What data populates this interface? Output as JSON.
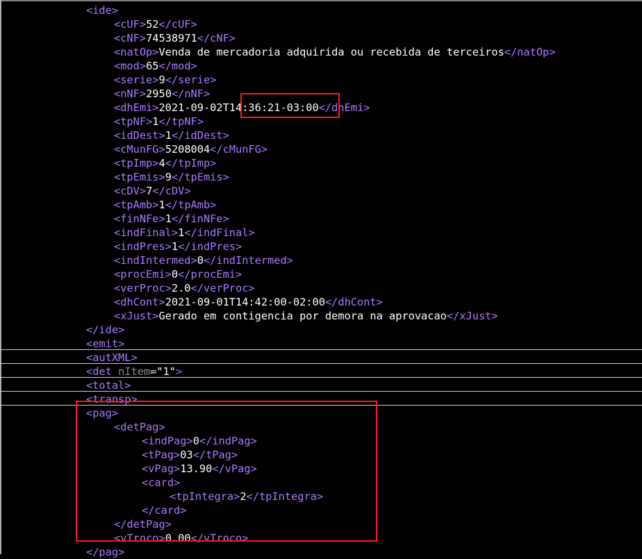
{
  "lines": [
    {
      "indent": 3,
      "parts": [
        {
          "t": "<ide>",
          "c": "t"
        }
      ]
    },
    {
      "indent": 4,
      "parts": [
        {
          "t": "<cUF>",
          "c": "t"
        },
        {
          "t": "52",
          "c": "x"
        },
        {
          "t": "</cUF>",
          "c": "t"
        }
      ]
    },
    {
      "indent": 4,
      "parts": [
        {
          "t": "<cNF>",
          "c": "t"
        },
        {
          "t": "74538971",
          "c": "x"
        },
        {
          "t": "</cNF>",
          "c": "t"
        }
      ]
    },
    {
      "indent": 4,
      "parts": [
        {
          "t": "<natOp>",
          "c": "t"
        },
        {
          "t": "Venda de mercadoria adquirida ou recebida de terceiros",
          "c": "x"
        },
        {
          "t": "</natOp>",
          "c": "t"
        }
      ]
    },
    {
      "indent": 4,
      "parts": [
        {
          "t": "<mod>",
          "c": "t"
        },
        {
          "t": "65",
          "c": "x"
        },
        {
          "t": "</mod>",
          "c": "t"
        }
      ]
    },
    {
      "indent": 4,
      "parts": [
        {
          "t": "<serie>",
          "c": "t"
        },
        {
          "t": "9",
          "c": "x"
        },
        {
          "t": "</serie>",
          "c": "t"
        }
      ]
    },
    {
      "indent": 4,
      "parts": [
        {
          "t": "<nNF>",
          "c": "t"
        },
        {
          "t": "2950",
          "c": "x"
        },
        {
          "t": "</nNF>",
          "c": "t"
        }
      ]
    },
    {
      "indent": 4,
      "parts": [
        {
          "t": "<dhEmi>",
          "c": "t"
        },
        {
          "t": "2021-09-02T14:36:21-03:00",
          "c": "x"
        },
        {
          "t": "</dhEmi>",
          "c": "t"
        }
      ]
    },
    {
      "indent": 4,
      "parts": [
        {
          "t": "<tpNF>",
          "c": "t"
        },
        {
          "t": "1",
          "c": "x"
        },
        {
          "t": "</tpNF>",
          "c": "t"
        }
      ]
    },
    {
      "indent": 4,
      "parts": [
        {
          "t": "<idDest>",
          "c": "t"
        },
        {
          "t": "1",
          "c": "x"
        },
        {
          "t": "</idDest>",
          "c": "t"
        }
      ]
    },
    {
      "indent": 4,
      "parts": [
        {
          "t": "<cMunFG>",
          "c": "t"
        },
        {
          "t": "5208004",
          "c": "x"
        },
        {
          "t": "</cMunFG>",
          "c": "t"
        }
      ]
    },
    {
      "indent": 4,
      "parts": [
        {
          "t": "<tpImp>",
          "c": "t"
        },
        {
          "t": "4",
          "c": "x"
        },
        {
          "t": "</tpImp>",
          "c": "t"
        }
      ]
    },
    {
      "indent": 4,
      "parts": [
        {
          "t": "<tpEmis>",
          "c": "t"
        },
        {
          "t": "9",
          "c": "x"
        },
        {
          "t": "</tpEmis>",
          "c": "t"
        }
      ]
    },
    {
      "indent": 4,
      "parts": [
        {
          "t": "<cDV>",
          "c": "t"
        },
        {
          "t": "7",
          "c": "x"
        },
        {
          "t": "</cDV>",
          "c": "t"
        }
      ]
    },
    {
      "indent": 4,
      "parts": [
        {
          "t": "<tpAmb>",
          "c": "t"
        },
        {
          "t": "1",
          "c": "x"
        },
        {
          "t": "</tpAmb>",
          "c": "t"
        }
      ]
    },
    {
      "indent": 4,
      "parts": [
        {
          "t": "<finNFe>",
          "c": "t"
        },
        {
          "t": "1",
          "c": "x"
        },
        {
          "t": "</finNFe>",
          "c": "t"
        }
      ]
    },
    {
      "indent": 4,
      "parts": [
        {
          "t": "<indFinal>",
          "c": "t"
        },
        {
          "t": "1",
          "c": "x"
        },
        {
          "t": "</indFinal>",
          "c": "t"
        }
      ]
    },
    {
      "indent": 4,
      "parts": [
        {
          "t": "<indPres>",
          "c": "t"
        },
        {
          "t": "1",
          "c": "x"
        },
        {
          "t": "</indPres>",
          "c": "t"
        }
      ]
    },
    {
      "indent": 4,
      "parts": [
        {
          "t": "<indIntermed>",
          "c": "t"
        },
        {
          "t": "0",
          "c": "x"
        },
        {
          "t": "</indIntermed>",
          "c": "t"
        }
      ]
    },
    {
      "indent": 4,
      "parts": [
        {
          "t": "<procEmi>",
          "c": "t"
        },
        {
          "t": "0",
          "c": "x"
        },
        {
          "t": "</procEmi>",
          "c": "t"
        }
      ]
    },
    {
      "indent": 4,
      "parts": [
        {
          "t": "<verProc>",
          "c": "t"
        },
        {
          "t": "2.0",
          "c": "x"
        },
        {
          "t": "</verProc>",
          "c": "t"
        }
      ]
    },
    {
      "indent": 4,
      "parts": [
        {
          "t": "<dhCont>",
          "c": "t"
        },
        {
          "t": "2021-09-01T14:42:00-02:00",
          "c": "x"
        },
        {
          "t": "</dhCont>",
          "c": "t"
        }
      ]
    },
    {
      "indent": 4,
      "parts": [
        {
          "t": "<xJust>",
          "c": "t"
        },
        {
          "t": "Gerado em contigencia por demora na aprovacao",
          "c": "x"
        },
        {
          "t": "</xJust>",
          "c": "t"
        }
      ]
    },
    {
      "indent": 3,
      "parts": [
        {
          "t": "</ide>",
          "c": "t"
        }
      ]
    },
    {
      "indent": 3,
      "parts": [
        {
          "t": "<emit>",
          "c": "t"
        }
      ]
    },
    {
      "indent": 3,
      "parts": [
        {
          "t": "<autXML>",
          "c": "t"
        }
      ]
    },
    {
      "indent": 3,
      "parts": [
        {
          "t": "<det ",
          "c": "t"
        },
        {
          "t": "nItem",
          "c": "an"
        },
        {
          "t": "=\"1\"",
          "c": "av"
        },
        {
          "t": ">",
          "c": "t"
        }
      ]
    },
    {
      "indent": 3,
      "parts": [
        {
          "t": "<total>",
          "c": "t"
        }
      ]
    },
    {
      "indent": 3,
      "parts": [
        {
          "t": "<transp>",
          "c": "t"
        }
      ]
    },
    {
      "indent": 3,
      "parts": [
        {
          "t": "<pag>",
          "c": "t"
        }
      ]
    },
    {
      "indent": 4,
      "parts": [
        {
          "t": "<detPag>",
          "c": "t"
        }
      ]
    },
    {
      "indent": 5,
      "parts": [
        {
          "t": "<indPag>",
          "c": "t"
        },
        {
          "t": "0",
          "c": "x"
        },
        {
          "t": "</indPag>",
          "c": "t"
        }
      ]
    },
    {
      "indent": 5,
      "parts": [
        {
          "t": "<tPag>",
          "c": "t"
        },
        {
          "t": "03",
          "c": "x"
        },
        {
          "t": "</tPag>",
          "c": "t"
        }
      ]
    },
    {
      "indent": 5,
      "parts": [
        {
          "t": "<vPag>",
          "c": "t"
        },
        {
          "t": "13.90",
          "c": "x"
        },
        {
          "t": "</vPag>",
          "c": "t"
        }
      ]
    },
    {
      "indent": 5,
      "parts": [
        {
          "t": "<card>",
          "c": "t"
        }
      ]
    },
    {
      "indent": 6,
      "parts": [
        {
          "t": "<tpIntegra>",
          "c": "t"
        },
        {
          "t": "2",
          "c": "x"
        },
        {
          "t": "</tpIntegra>",
          "c": "t"
        }
      ]
    },
    {
      "indent": 5,
      "parts": [
        {
          "t": "</card>",
          "c": "t"
        }
      ]
    },
    {
      "indent": 4,
      "parts": [
        {
          "t": "</detPag>",
          "c": "t"
        }
      ]
    },
    {
      "indent": 4,
      "parts": [
        {
          "t": "<vTroco>",
          "c": "t"
        },
        {
          "t": "0.00",
          "c": "x"
        },
        {
          "t": "</vTroco>",
          "c": "t"
        }
      ]
    },
    {
      "indent": 3,
      "parts": [
        {
          "t": "</pag>",
          "c": "t"
        }
      ]
    }
  ],
  "colors": {
    "tag": "#a77bff",
    "text": "#ffffff",
    "attr_name": "#888888",
    "highlight": "#ff1a1a",
    "background": "#000000"
  }
}
